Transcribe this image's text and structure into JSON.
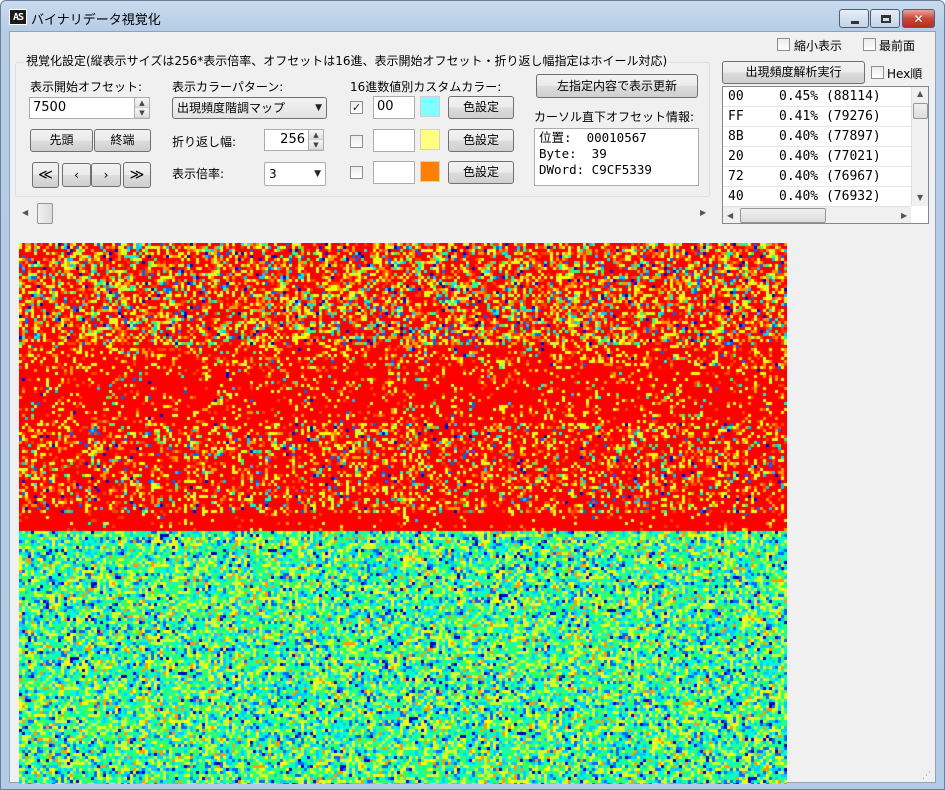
{
  "window": {
    "title": "バイナリデータ視覚化",
    "app_icon_text": "AS"
  },
  "top_checks": {
    "compact": {
      "label": "縮小表示",
      "checked": false
    },
    "topmost": {
      "label": "最前面",
      "checked": false
    }
  },
  "settings": {
    "group_title": "視覚化設定(縦表示サイズは256*表示倍率、オフセットは16進、表示開始オフセット・折り返し幅指定はホイール対応)",
    "start_offset_label": "表示開始オフセット:",
    "start_offset_value": "7500",
    "head_button": "先頭",
    "end_button": "終端",
    "nav": {
      "first": "≪",
      "prev": "‹",
      "next": "›",
      "last": "≫"
    },
    "color_pattern_label": "表示カラーパターン:",
    "color_pattern_value": "出現頻度階調マップ",
    "wrap_label": "折り返し幅:",
    "wrap_value": "256",
    "zoom_label": "表示倍率:",
    "zoom_value": "3",
    "custom_color_label": "16進数値別カスタムカラー:",
    "custom_colors": [
      {
        "checked": true,
        "hex": "00",
        "color": "#80ffff",
        "button": "色設定"
      },
      {
        "checked": false,
        "hex": "",
        "color": "#ffff80",
        "button": "色設定"
      },
      {
        "checked": false,
        "hex": "",
        "color": "#ff8000",
        "button": "色設定"
      }
    ],
    "refresh_button": "左指定内容で表示更新",
    "cursor_info_label": "カーソル直下オフセット情報:",
    "cursor_info": {
      "position_line": "位置:  00010567",
      "byte_line": "Byte:  39",
      "dword_line": "DWord: C9CF5339"
    }
  },
  "freq": {
    "run_button": "出現頻度解析実行",
    "hex_order": {
      "label": "Hex順",
      "checked": false
    },
    "rows": [
      {
        "byte": "00",
        "pct": "0.45% (88114)"
      },
      {
        "byte": "FF",
        "pct": "0.41% (79276)"
      },
      {
        "byte": "8B",
        "pct": "0.40% (77897)"
      },
      {
        "byte": "20",
        "pct": "0.40% (77021)"
      },
      {
        "byte": "72",
        "pct": "0.40% (76967)"
      },
      {
        "byte": "40",
        "pct": "0.40% (76932)"
      }
    ]
  },
  "colors": {
    "accent_red": "#ff0000",
    "palette": [
      "#ff0000",
      "#ff4000",
      "#ff9900",
      "#ffff00",
      "#ccff33",
      "#33ff66",
      "#00ffcc",
      "#00ccff",
      "#0066ff",
      "#0000cc"
    ]
  }
}
